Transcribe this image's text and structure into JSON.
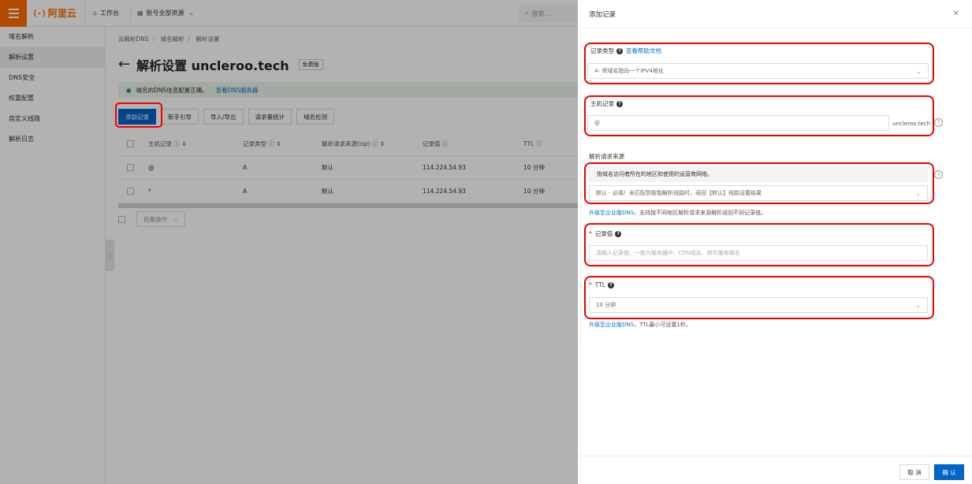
{
  "topbar": {
    "logo_text": "阿里云",
    "logo_mark": "(-)",
    "workbench": "工作台",
    "account_resources": "账号全部资源",
    "search_placeholder": "搜索..."
  },
  "sidebar": {
    "items": [
      {
        "label": "域名解析",
        "active": false
      },
      {
        "label": "解析设置",
        "active": true
      },
      {
        "label": "DNS安全",
        "active": false
      },
      {
        "label": "权重配置",
        "active": false
      },
      {
        "label": "自定义线路",
        "active": false
      },
      {
        "label": "解析日志",
        "active": false
      }
    ]
  },
  "breadcrumb": [
    "云解析DNS",
    "域名解析",
    "解析设置"
  ],
  "page": {
    "title": "解析设置 uncleroo.tech",
    "plan_badge": "免费版",
    "notice_text": "域名的DNS信息配置正确。",
    "notice_link": "查看DNS服务器"
  },
  "toolbar": {
    "add_record": "添加记录",
    "guide": "新手引导",
    "import_export": "导入/导出",
    "request_stats": "请求量统计",
    "domain_check": "域名检测"
  },
  "table": {
    "headers": {
      "host": "主机记录 ⓘ ⇕",
      "type": "记录类型 ⓘ ⇕",
      "isp": "解析请求来源(isp) ⓘ ⇕",
      "value": "记录值 ⓘ",
      "ttl": "TTL ⓘ"
    },
    "rows": [
      {
        "host": "@",
        "type": "A",
        "isp": "默认",
        "value": "114.224.54.93",
        "ttl": "10 分钟"
      },
      {
        "host": "*",
        "type": "A",
        "isp": "默认",
        "value": "114.224.54.93",
        "ttl": "10 分钟"
      }
    ],
    "batch_label": "批量操作"
  },
  "drawer": {
    "title": "添加记录",
    "record_type_label": "记录类型",
    "help_doc": "查看帮助文档",
    "record_type_value": "A- 将域名指向一个IPV4地址",
    "host_label": "主机记录",
    "host_value": "@",
    "host_suffix": ".uncleroo.tech",
    "isp_label": "解析请求来源",
    "isp_info": "指域名访问者所在的地区和使用的运营商网络。",
    "isp_value": "默认 - 必填！未匹配到智能解析线路时，返回【默认】线路设置结果",
    "isp_hint_link": "升级至企业版DNS",
    "isp_hint_text": "，支持按不同地区解析请求来源解析返回不同记录值。",
    "value_label": "记录值",
    "value_placeholder": "请输入记录值，一般为服务器IP、CDN域名、邮件服务域名",
    "ttl_label": "TTL",
    "ttl_value": "10 分钟",
    "ttl_hint_link": "升级至企业版DNS",
    "ttl_hint_text": "，TTL最小可设置1秒。",
    "cancel": "取 消",
    "confirm": "确 认"
  },
  "colors": {
    "brand": "#ff6a00",
    "primary": "#0064c8",
    "highlight": "#e00000"
  }
}
